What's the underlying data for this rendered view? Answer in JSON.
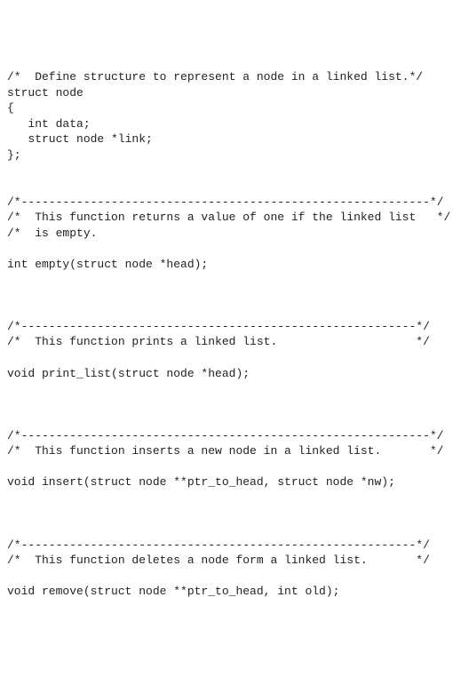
{
  "lines": {
    "l01": "/*  Define structure to represent a node in a linked list.*/",
    "l02": "struct node",
    "l03": "{",
    "l04": "   int data;",
    "l05": "   struct node *link;",
    "l06": "};",
    "l07": "",
    "l08": "",
    "l09": "/*-----------------------------------------------------------*/",
    "l10": "/*  This function returns a value of one if the linked list   */",
    "l11": "/*  is empty.",
    "l12": "",
    "l13": "int empty(struct node *head);",
    "l14": "",
    "l15": "",
    "l16": "",
    "l17": "/*---------------------------------------------------------*/",
    "l18": "/*  This function prints a linked list.                    */",
    "l19": "",
    "l20": "void print_list(struct node *head);",
    "l21": "",
    "l22": "",
    "l23": "",
    "l24": "/*-----------------------------------------------------------*/",
    "l25": "/*  This function inserts a new node in a linked list.       */",
    "l26": "",
    "l27": "void insert(struct node **ptr_to_head, struct node *nw);",
    "l28": "",
    "l29": "",
    "l30": "",
    "l31": "/*---------------------------------------------------------*/",
    "l32": "/*  This function deletes a node form a linked list.       */",
    "l33": "",
    "l34": "void remove(struct node **ptr_to_head, int old);"
  }
}
